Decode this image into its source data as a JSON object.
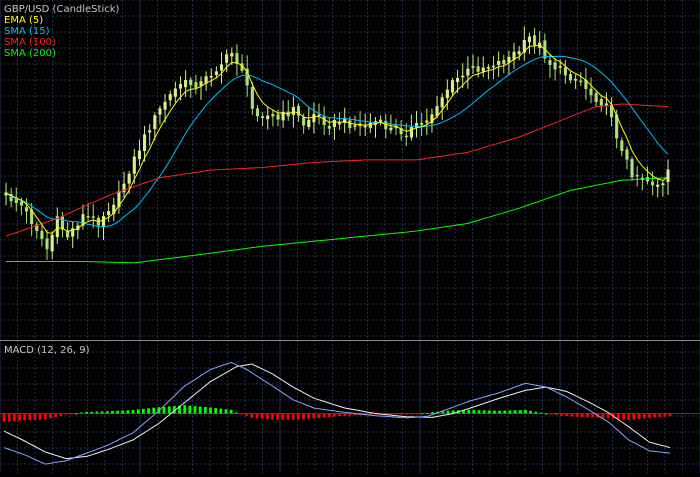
{
  "colors": {
    "background": "#000000",
    "grid": "#1f3252",
    "panel_border": "#8c8c8c",
    "bull_candle": "#d8f08a",
    "bear_candle": "#aee07a",
    "ema5": "#ffff00",
    "sma15": "#00c0ff",
    "sma100": "#ff2020",
    "sma200": "#00ff00",
    "macd_line": "#8aa2ff",
    "signal_line": "#f0f0f0",
    "hist_pos": "#00ff00",
    "hist_neg": "#ff0000"
  },
  "chart_data": [
    {
      "type": "candlestick",
      "title": "GBP/USD (CandleStick)",
      "grid": true,
      "legend_position": "top-left",
      "candle_count": 130,
      "legend": [
        {
          "label": "EMA (5)",
          "color_key": "ema5"
        },
        {
          "label": "SMA (15)",
          "color_key": "sma15"
        },
        {
          "label": "SMA (100)",
          "color_key": "sma100"
        },
        {
          "label": "SMA (200)",
          "color_key": "sma200"
        }
      ],
      "close_path": [
        [
          0,
          0.62
        ],
        [
          3,
          0.66
        ],
        [
          6,
          0.75
        ],
        [
          8,
          0.83
        ],
        [
          10,
          0.72
        ],
        [
          12,
          0.78
        ],
        [
          15,
          0.7
        ],
        [
          18,
          0.72
        ],
        [
          22,
          0.62
        ],
        [
          24,
          0.52
        ],
        [
          28,
          0.35
        ],
        [
          31,
          0.25
        ],
        [
          34,
          0.18
        ],
        [
          38,
          0.18
        ],
        [
          42,
          0.1
        ],
        [
          44,
          0.06
        ],
        [
          46,
          0.12
        ],
        [
          48,
          0.28
        ],
        [
          50,
          0.3
        ],
        [
          53,
          0.32
        ],
        [
          56,
          0.28
        ],
        [
          58,
          0.34
        ],
        [
          60,
          0.3
        ],
        [
          63,
          0.34
        ],
        [
          66,
          0.33
        ],
        [
          69,
          0.35
        ],
        [
          72,
          0.33
        ],
        [
          75,
          0.36
        ],
        [
          78,
          0.37
        ],
        [
          80,
          0.35
        ],
        [
          82,
          0.33
        ],
        [
          84,
          0.26
        ],
        [
          86,
          0.2
        ],
        [
          88,
          0.16
        ],
        [
          91,
          0.12
        ],
        [
          94,
          0.11
        ],
        [
          97,
          0.09
        ],
        [
          100,
          0.05
        ],
        [
          102,
          0.0
        ],
        [
          104,
          0.03
        ],
        [
          106,
          0.1
        ],
        [
          109,
          0.14
        ],
        [
          112,
          0.17
        ],
        [
          114,
          0.22
        ],
        [
          116,
          0.25
        ],
        [
          118,
          0.3
        ],
        [
          119,
          0.38
        ],
        [
          120,
          0.45
        ],
        [
          122,
          0.53
        ],
        [
          124,
          0.55
        ],
        [
          126,
          0.57
        ],
        [
          128,
          0.58
        ],
        [
          129,
          0.53
        ]
      ],
      "sma100_path": [
        [
          0,
          0.78
        ],
        [
          10,
          0.71
        ],
        [
          20,
          0.62
        ],
        [
          30,
          0.55
        ],
        [
          40,
          0.52
        ],
        [
          50,
          0.51
        ],
        [
          60,
          0.49
        ],
        [
          70,
          0.48
        ],
        [
          80,
          0.48
        ],
        [
          90,
          0.45
        ],
        [
          100,
          0.39
        ],
        [
          110,
          0.31
        ],
        [
          115,
          0.27
        ],
        [
          120,
          0.26
        ],
        [
          129,
          0.27
        ]
      ],
      "sma200_path": [
        [
          0,
          0.88
        ],
        [
          15,
          0.88
        ],
        [
          25,
          0.885
        ],
        [
          35,
          0.86
        ],
        [
          50,
          0.82
        ],
        [
          70,
          0.78
        ],
        [
          80,
          0.76
        ],
        [
          90,
          0.73
        ],
        [
          100,
          0.67
        ],
        [
          110,
          0.6
        ],
        [
          120,
          0.56
        ],
        [
          129,
          0.55
        ]
      ]
    },
    {
      "type": "macd",
      "title": "MACD (12, 26, 9)",
      "grid": true,
      "bar_count": 130,
      "macd_path": [
        [
          0,
          -0.62
        ],
        [
          4,
          -0.75
        ],
        [
          8,
          -0.92
        ],
        [
          12,
          -0.86
        ],
        [
          16,
          -0.72
        ],
        [
          20,
          -0.58
        ],
        [
          25,
          -0.35
        ],
        [
          30,
          0.05
        ],
        [
          35,
          0.5
        ],
        [
          40,
          0.8
        ],
        [
          44,
          0.93
        ],
        [
          47,
          0.8
        ],
        [
          52,
          0.5
        ],
        [
          56,
          0.25
        ],
        [
          60,
          0.1
        ],
        [
          66,
          0.02
        ],
        [
          72,
          -0.04
        ],
        [
          78,
          -0.08
        ],
        [
          82,
          -0.05
        ],
        [
          86,
          0.08
        ],
        [
          90,
          0.22
        ],
        [
          96,
          0.38
        ],
        [
          101,
          0.55
        ],
        [
          105,
          0.48
        ],
        [
          109,
          0.3
        ],
        [
          113,
          0.08
        ],
        [
          117,
          -0.15
        ],
        [
          121,
          -0.48
        ],
        [
          125,
          -0.68
        ],
        [
          129,
          -0.72
        ]
      ],
      "signal_path": [
        [
          0,
          -0.32
        ],
        [
          4,
          -0.5
        ],
        [
          8,
          -0.7
        ],
        [
          12,
          -0.82
        ],
        [
          16,
          -0.78
        ],
        [
          20,
          -0.66
        ],
        [
          25,
          -0.48
        ],
        [
          30,
          -0.18
        ],
        [
          35,
          0.2
        ],
        [
          40,
          0.58
        ],
        [
          45,
          0.85
        ],
        [
          48,
          0.9
        ],
        [
          52,
          0.72
        ],
        [
          56,
          0.48
        ],
        [
          60,
          0.28
        ],
        [
          66,
          0.1
        ],
        [
          72,
          0.0
        ],
        [
          78,
          -0.06
        ],
        [
          83,
          -0.07
        ],
        [
          87,
          0.0
        ],
        [
          91,
          0.12
        ],
        [
          96,
          0.28
        ],
        [
          101,
          0.42
        ],
        [
          105,
          0.48
        ],
        [
          109,
          0.4
        ],
        [
          113,
          0.22
        ],
        [
          117,
          0.02
        ],
        [
          121,
          -0.24
        ],
        [
          125,
          -0.52
        ],
        [
          129,
          -0.62
        ]
      ]
    }
  ]
}
